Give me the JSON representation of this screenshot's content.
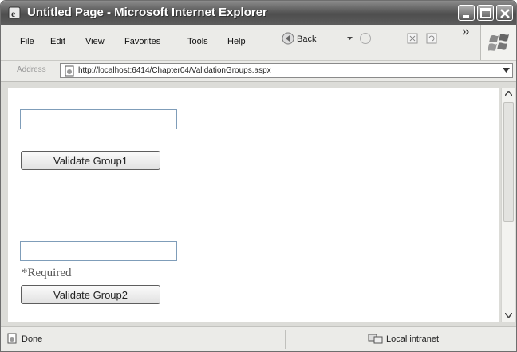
{
  "window": {
    "title": "Untitled Page - Microsoft Internet Explorer"
  },
  "menu": [
    "File",
    "Edit",
    "View",
    "Favorites",
    "Tools",
    "Help"
  ],
  "toolbar": {
    "back_label": "Back"
  },
  "address": {
    "label": "Address",
    "url": "http://localhost:6414/Chapter04/ValidationGroups.aspx"
  },
  "form": {
    "group1_input": "",
    "group1_button": "Validate Group1",
    "group2_input": "",
    "required_message": "*Required",
    "group2_button": "Validate Group2"
  },
  "status": {
    "text": "Done",
    "zone": "Local intranet"
  }
}
